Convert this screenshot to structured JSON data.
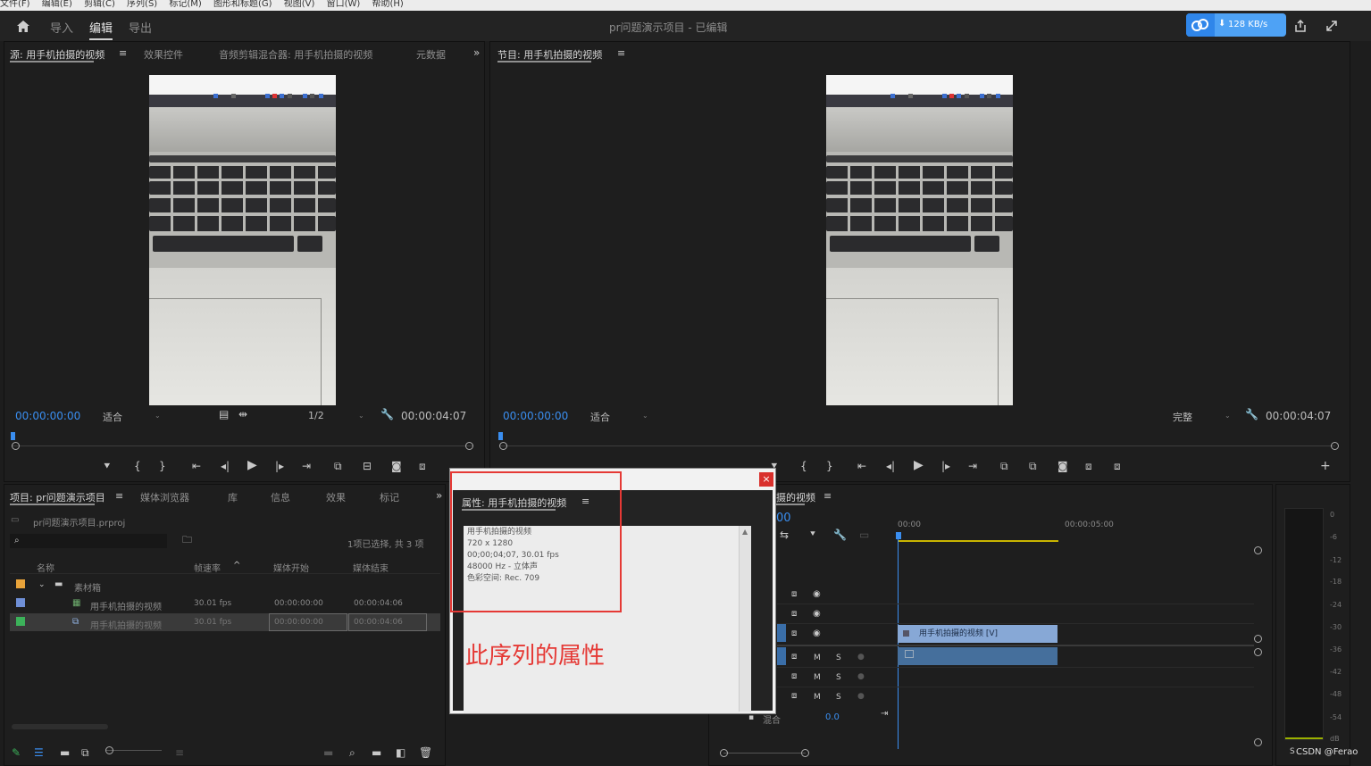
{
  "menu": [
    "文件(F)",
    "编辑(E)",
    "剪辑(C)",
    "序列(S)",
    "标记(M)",
    "图形和标题(G)",
    "视图(V)",
    "窗口(W)",
    "帮助(H)"
  ],
  "workspaces": {
    "import": "导入",
    "edit": "编辑",
    "export": "导出"
  },
  "project_title": "pr问题演示项目 - 已编辑",
  "net_speed": "128 KB/s",
  "source_panel": {
    "tabs": [
      "源: 用手机拍摄的视频",
      "效果控件",
      "音频剪辑混合器: 用手机拍摄的视频",
      "元数据"
    ],
    "timecode_in": "00:00:00:00",
    "fit": "适合",
    "resolution": "1/2",
    "duration": "00:00:04:07"
  },
  "program_panel": {
    "tab": "节目: 用手机拍摄的视频",
    "timecode_in": "00:00:00:00",
    "fit": "适合",
    "quality": "完整",
    "duration": "00:00:04:07"
  },
  "project_panel": {
    "tabs": [
      "项目: pr问题演示项目",
      "媒体浏览器",
      "库",
      "信息",
      "效果",
      "标记"
    ],
    "file": "pr问题演示项目.prproj",
    "selection_info": "1项已选择, 共 3 项",
    "columns": [
      "名称",
      "帧速率",
      "媒体开始",
      "媒体结束"
    ],
    "rows": [
      {
        "name": "素材箱",
        "fps": "",
        "start": "",
        "end": "",
        "color": "#e8a33a"
      },
      {
        "name": "用手机拍摄的视频",
        "fps": "30.01 fps",
        "start": "00:00:00:00",
        "end": "00:00:04:06",
        "color": "#6f8fd6"
      },
      {
        "name": "用手机拍摄的视频",
        "fps": "30.01 fps",
        "start": "00:00:00:00",
        "end": "00:00:04:06",
        "color": "#3cb25a"
      }
    ]
  },
  "properties_dialog": {
    "tab": "属性: 用手机拍摄的视频",
    "lines": [
      "用手机拍摄的视频",
      "720 x 1280",
      "00;00;04;07, 30.01 fps",
      "48000 Hz - 立体声",
      "色彩空间: Rec. 709"
    ]
  },
  "annotation": "此序列的属性",
  "timeline": {
    "tab_suffix": "摄的视频",
    "timecode_partial": "00",
    "ruler": [
      "00:00",
      "00:00:05:00"
    ],
    "clip_label": "用手机拍摄的视频 [V]",
    "mix_label": "混合",
    "mix_value": "0.0",
    "track_letters": [
      "M",
      "S"
    ]
  },
  "meter_scale": [
    "0",
    "-6",
    "-12",
    "-18",
    "-24",
    "-30",
    "-36",
    "-42",
    "-48",
    "-54",
    "dB"
  ],
  "watermark": "CSDN @Ferao",
  "watermark_left": "S"
}
